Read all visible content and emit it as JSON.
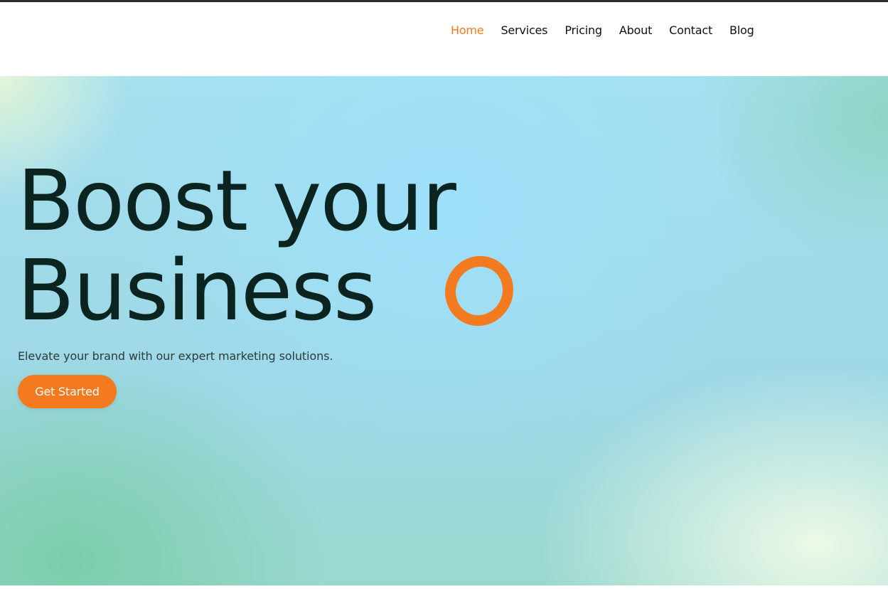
{
  "nav": {
    "items": [
      {
        "label": "Home",
        "active": true
      },
      {
        "label": "Services",
        "active": false
      },
      {
        "label": "Pricing",
        "active": false
      },
      {
        "label": "About",
        "active": false
      },
      {
        "label": "Contact",
        "active": false
      },
      {
        "label": "Blog",
        "active": false
      }
    ]
  },
  "hero": {
    "headline_line1": "Boost your",
    "headline_line2": "Business",
    "decoration_icon": "orange-ring-icon",
    "subtitle": "Elevate your brand with our expert marketing solutions.",
    "cta_label": "Get Started"
  },
  "colors": {
    "accent": "#f47a1f",
    "headline": "#0b2420",
    "nav_text": "#111111",
    "top_border": "#2b2b2b"
  }
}
